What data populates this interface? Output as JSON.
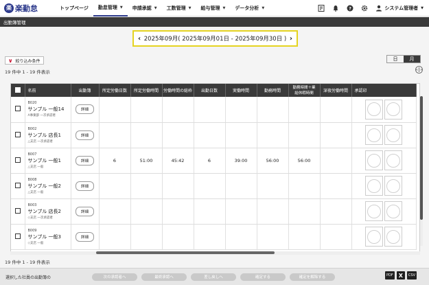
{
  "app": {
    "logo_mark": "楽",
    "logo_text": "楽勤怠"
  },
  "nav": {
    "items": [
      {
        "label": "トップページ",
        "dropdown": false,
        "active": false
      },
      {
        "label": "勤怠管理",
        "dropdown": true,
        "active": true
      },
      {
        "label": "申請承認",
        "dropdown": true,
        "active": false
      },
      {
        "label": "工数管理",
        "dropdown": true,
        "active": false
      },
      {
        "label": "給与管理",
        "dropdown": true,
        "active": false
      },
      {
        "label": "データ分析",
        "dropdown": true,
        "active": false
      }
    ],
    "user_label": "システム管理者"
  },
  "page": {
    "title": "出勤簿管理"
  },
  "period": {
    "label": "2025年09月( 2025年09月01日 - 2025年09月30日 )"
  },
  "filter": {
    "label": "絞り込み条件"
  },
  "view_toggle": {
    "day": "日",
    "month": "月",
    "selected": "月"
  },
  "counts": {
    "top": "19 件中 1 - 19 件表示",
    "bottom": "19 件中 1 - 19 件表示"
  },
  "table": {
    "headers": {
      "name": "名前",
      "attendance": "出勤簿",
      "scheduled_days": "所定労働日数",
      "scheduled_hours": "所定労働時間",
      "total_work_frame": "労働時間の総枠",
      "work_days": "出勤日数",
      "actual_hours": "実働時間",
      "working_hours": "勤務時間",
      "work_plus_break": "勤務時間＋業\n給休暇時間",
      "night_hours": "深夜労働時間",
      "approval_stamp": "承認印"
    },
    "detail_label": "詳細",
    "rows": [
      {
        "code": "B020",
        "name": "サンプル 一般14",
        "group": "A事業部 一次承認者",
        "scheduled_days": "",
        "scheduled_hours": "",
        "total_frame": "",
        "work_days": "",
        "actual": "",
        "working": "",
        "work_break": "",
        "night": ""
      },
      {
        "code": "B002",
        "name": "サンプル 店長1",
        "group": "△支店 一次承認者",
        "scheduled_days": "",
        "scheduled_hours": "",
        "total_frame": "",
        "work_days": "",
        "actual": "",
        "working": "",
        "work_break": "",
        "night": ""
      },
      {
        "code": "B007",
        "name": "サンプル 一般1",
        "group": "△支店 一般",
        "scheduled_days": "6",
        "scheduled_hours": "51:00",
        "total_frame": "45:42",
        "work_days": "6",
        "actual": "39:00",
        "working": "56:00",
        "work_break": "56:00",
        "night": ""
      },
      {
        "code": "B008",
        "name": "サンプル 一般2",
        "group": "△支店 一般",
        "scheduled_days": "",
        "scheduled_hours": "",
        "total_frame": "",
        "work_days": "",
        "actual": "",
        "working": "",
        "work_break": "",
        "night": ""
      },
      {
        "code": "B003",
        "name": "サンプル 店長2",
        "group": "◇支店 一次承認者",
        "scheduled_days": "",
        "scheduled_hours": "",
        "total_frame": "",
        "work_days": "",
        "actual": "",
        "working": "",
        "work_break": "",
        "night": ""
      },
      {
        "code": "B009",
        "name": "サンプル 一般3",
        "group": "◇支店 一般",
        "scheduled_days": "",
        "scheduled_hours": "",
        "total_frame": "",
        "work_days": "",
        "actual": "",
        "working": "",
        "work_break": "",
        "night": ""
      }
    ]
  },
  "footer": {
    "label": "選択した社員の出勤簿の",
    "buttons": [
      {
        "label": "次の承認者へ",
        "width": 66
      },
      {
        "label": "最終承認へ",
        "width": 66
      },
      {
        "label": "差し戻しへ",
        "width": 66
      },
      {
        "label": "確定する",
        "width": 66
      },
      {
        "label": "確定を解除する",
        "width": 66
      }
    ],
    "exports": [
      "PDF",
      "X",
      "CSV"
    ]
  },
  "colors": {
    "accent": "#2d3a8c",
    "header_bg": "#3a3a3a",
    "highlight": "#e5d320",
    "filter_chevron": "#c8102e"
  }
}
